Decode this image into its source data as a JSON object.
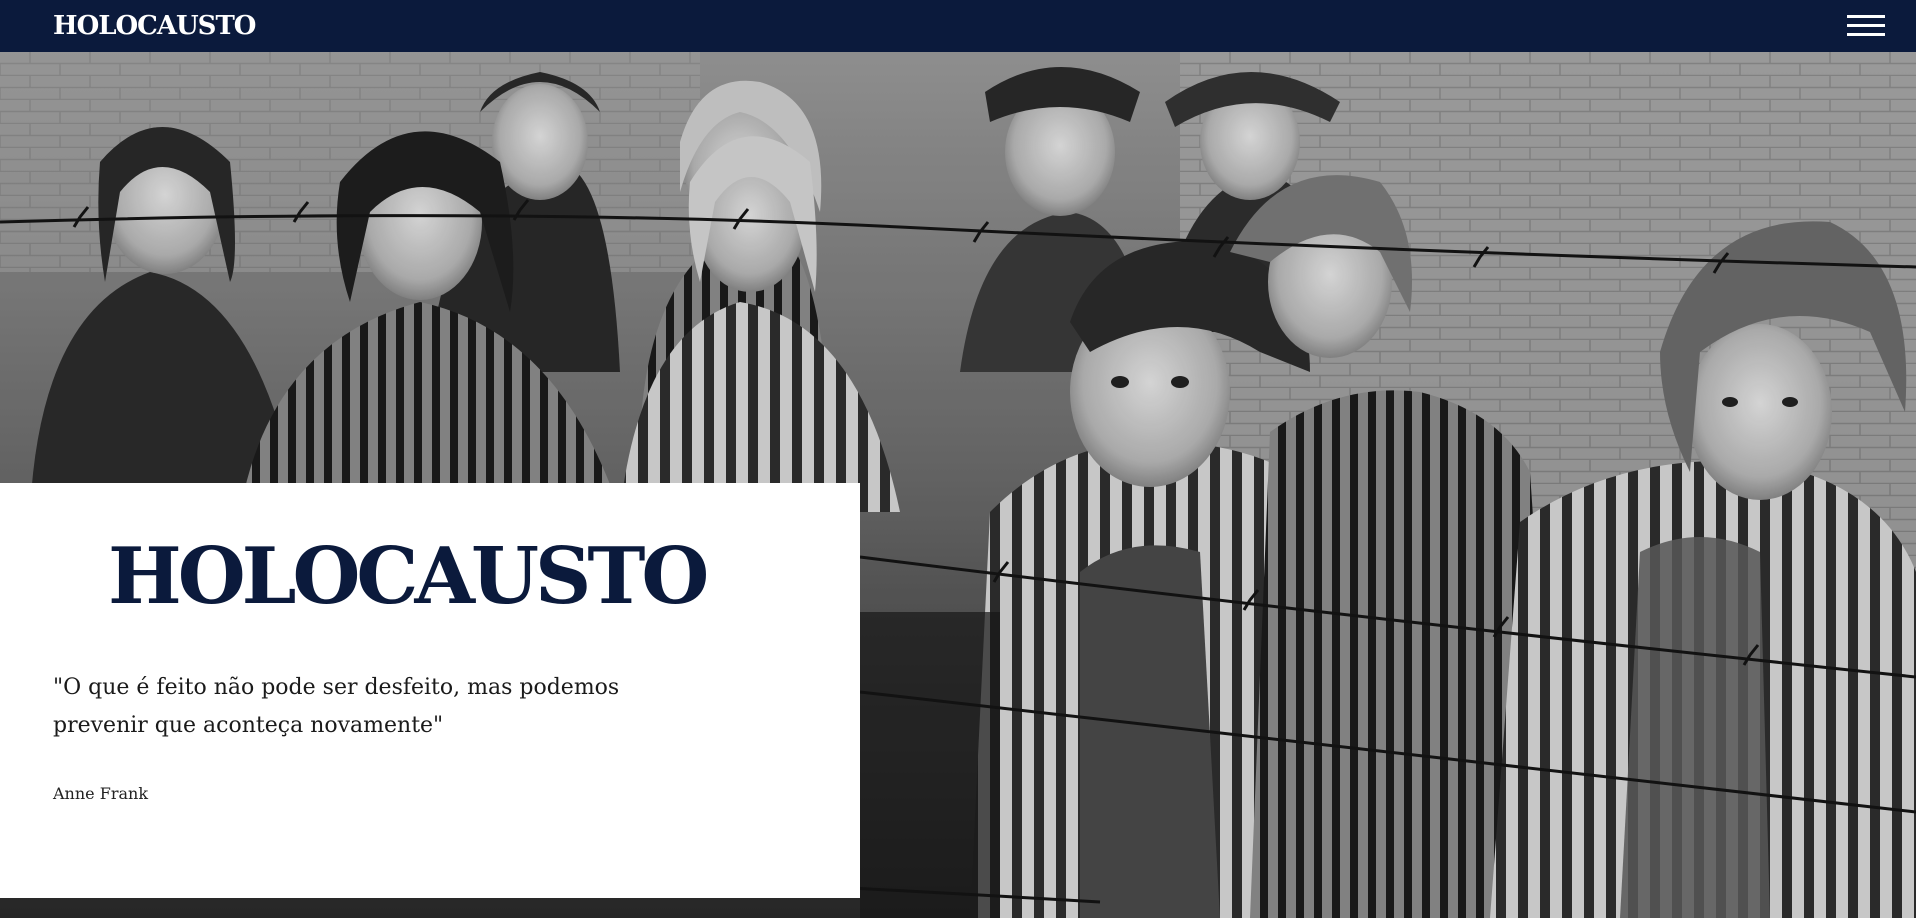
{
  "navbar": {
    "brand": "HOLOCAUSTO",
    "menu_icon": "hamburger-menu-icon"
  },
  "hero": {
    "image_description_icon": "historical-photo",
    "card": {
      "title": "HOLOCAUSTO",
      "quote": "\"O que é feito não pode ser desfeito, mas podemos prevenir que aconteça novamente\"",
      "author": "Anne Frank"
    }
  },
  "colors": {
    "navy": "#0b1a3c",
    "card_bg": "#ffffff",
    "text_dark": "#1a1a1a"
  }
}
